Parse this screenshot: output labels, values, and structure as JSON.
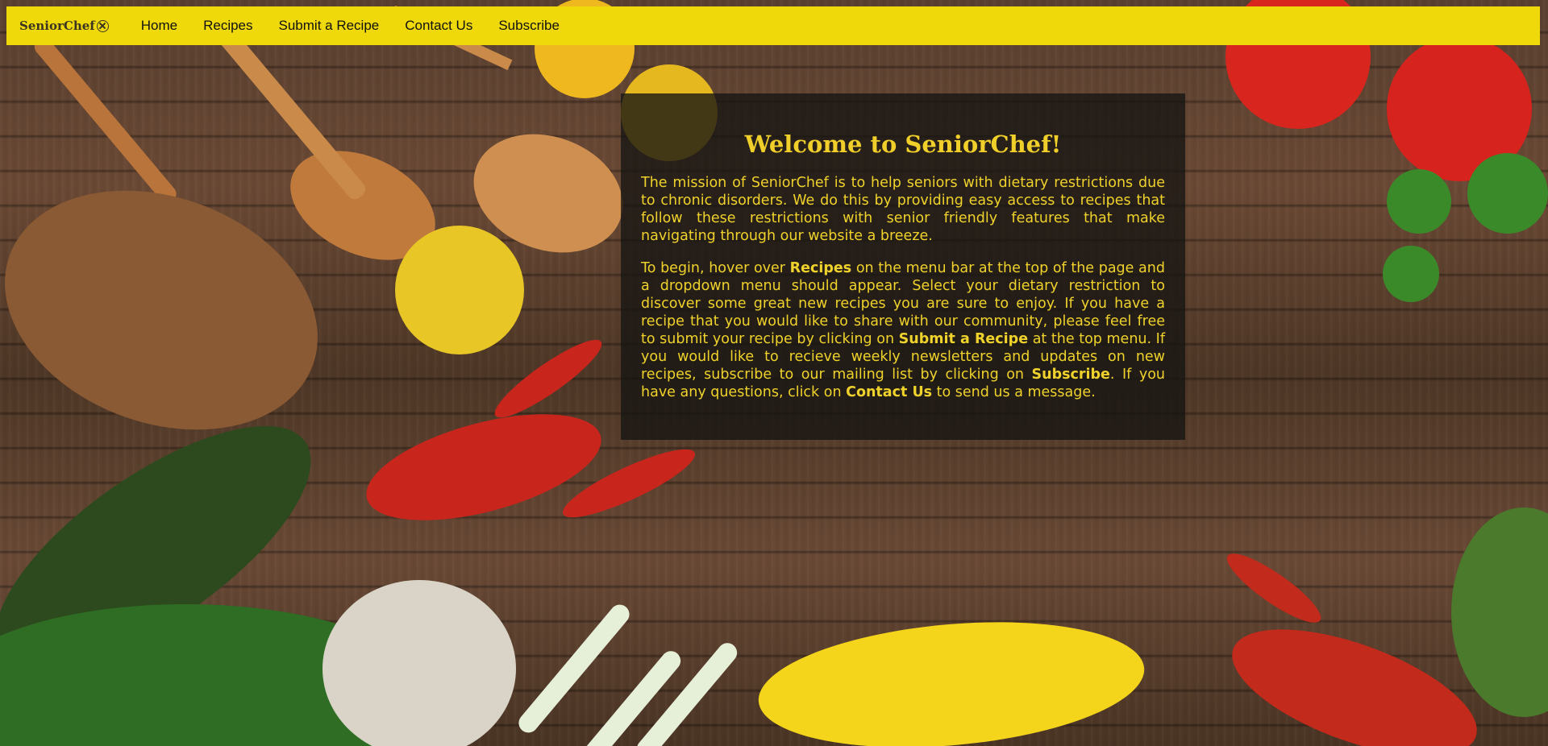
{
  "navbar": {
    "brand": "SeniorChef",
    "links": [
      "Home",
      "Recipes",
      "Submit a Recipe",
      "Contact Us",
      "Subscribe"
    ]
  },
  "welcome": {
    "title": "Welcome to SeniorChef!",
    "mission": "The mission of SeniorChef is to help seniors with dietary restrictions due to chronic disorders. We do this by providing easy access to recipes that follow these restrictions with senior friendly features that make navigating through our website a breeze.",
    "instructions": {
      "t1": "To begin, hover over ",
      "b1": "Recipes",
      "t2": " on the menu bar at the top of the page and a dropdown menu should appear. Select your dietary restriction to discover some great new recipes you are sure to enjoy. If you have a recipe that you would like to share with our community, please feel free to submit your recipe by clicking on ",
      "b2": "Submit a Recipe",
      "t3": " at the top menu. If you would like to recieve weekly newsletters and updates on new recipes, subscribe to our mailing list by clicking on ",
      "b3": "Subscribe",
      "t4": ". If you have any questions, click on ",
      "b4": "Contact Us",
      "t5": " to send us a message."
    }
  },
  "colors": {
    "navbar_bg": "#efd90b",
    "panel_text": "#efd22b",
    "panel_bg": "rgba(22,20,18,0.78)"
  },
  "icons": {
    "brand_icon": "circle-x-icon"
  }
}
